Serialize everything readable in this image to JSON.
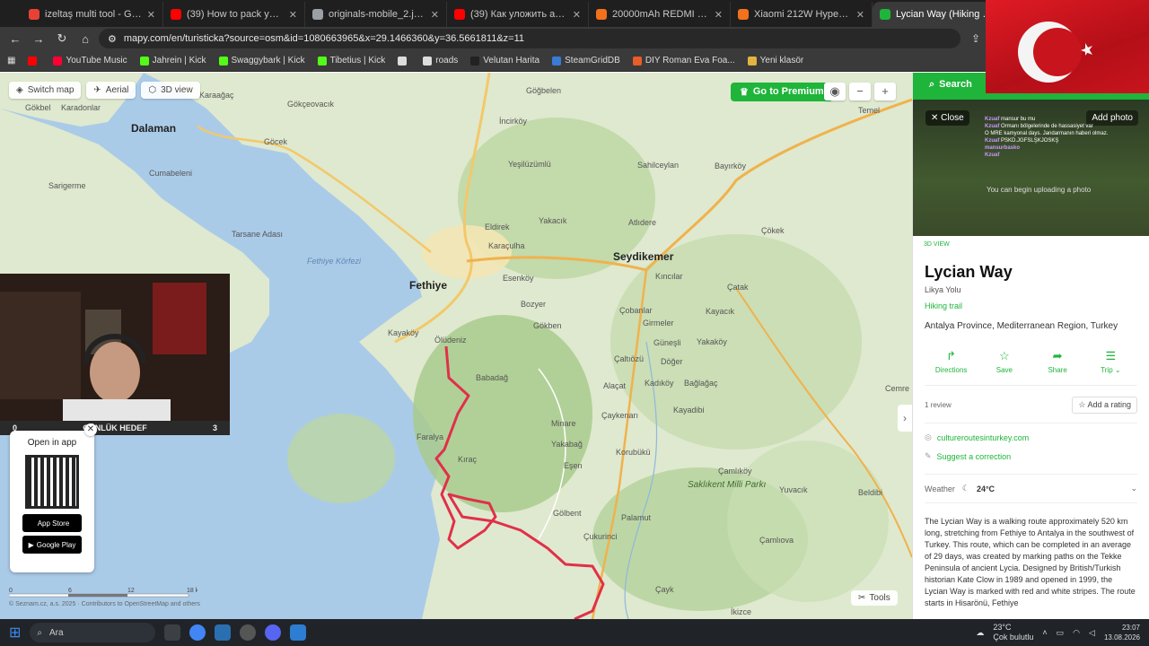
{
  "browser": {
    "tabs": [
      {
        "title": "izeltaş multi tool - Google Alışv",
        "color": "#e94235"
      },
      {
        "title": "(39) How to pack your backpac",
        "color": "#ff0000"
      },
      {
        "title": "originals-mobile_2.jpg (1000×",
        "color": "#9aa0a6"
      },
      {
        "title": "(39) Как уложить алкаша без",
        "color": "#ff0000"
      },
      {
        "title": "20000mAh REDMI 18W Fast Ch",
        "color": "#f2711c"
      },
      {
        "title": "Xiaomi 212W HyperCharge Po",
        "color": "#f2711c"
      },
      {
        "title": "Lycian Way (Hiking trail) • M",
        "color": "#1eb53a"
      }
    ],
    "url": "mapy.com/en/turisticka?source=osm&id=1080663965&x=29.1466360&y=36.5661811&z=11",
    "bookmarks": [
      {
        "label": "",
        "color": "#ff0000"
      },
      {
        "label": "YouTube Music",
        "color": "#ff0033"
      },
      {
        "label": "Jahrein | Kick",
        "color": "#53fc18"
      },
      {
        "label": "Swaggybark | Kick",
        "color": "#53fc18"
      },
      {
        "label": "Tibetius | Kick",
        "color": "#53fc18"
      },
      {
        "label": "",
        "color": "#dddddd"
      },
      {
        "label": "roads",
        "color": "#dddddd"
      },
      {
        "label": "Velutan Harita",
        "color": "#222222"
      },
      {
        "label": "SteamGridDB",
        "color": "#3a7bd5"
      },
      {
        "label": "DIY Roman Eva Foa...",
        "color": "#e85d2a"
      },
      {
        "label": "Yeni klasör",
        "color": "#e3b341"
      }
    ]
  },
  "map": {
    "controls": {
      "switch": "Switch map",
      "aerial": "Aerial",
      "view3d": "3D view"
    },
    "premium": "Go to Premium",
    "tools": "Tools",
    "labels": {
      "dalaman": "Dalaman",
      "fethiye": "Fethiye",
      "seydikemer": "Seydikemer",
      "gocek": "Göcek",
      "gokbel": "Gökbel",
      "karadonlar": "Karadonlar",
      "gokcekovacik": "Gökçeovacık",
      "karaagac": "Karaağaç",
      "cumabeleni": "Cumabeleni",
      "sarigerme": "Sarigerme",
      "gogbelen": "Göğbelen",
      "incirkoy": "İncirköy",
      "yesiluzumlu": "Yeşilüzümlü",
      "sahilceylan": "Sahilceylan",
      "bayirkoy": "Bayırköy",
      "temel": "Temel",
      "yakacik": "Yakacık",
      "atlidere": "Atlıdere",
      "eldirek": "Eldirek",
      "karaculha": "Karaçulha",
      "cokek": "Çökek",
      "kincilar": "Kıncılar",
      "esenkoy": "Esenköy",
      "bozyer": "Bozyer",
      "gokben": "Gökben",
      "catak": "Çatak",
      "cobanlar": "Çobanlar",
      "girmeler": "Girmeler",
      "kayacik": "Kayacık",
      "gunesli": "Güneşli",
      "yakakoy": "Yakaköy",
      "caltiozu": "Çaltıözü",
      "doger": "Döğer",
      "alacat": "Alaçat",
      "kadikoy": "Kadıköy",
      "baglagac": "Bağlağaç",
      "cayken": "Çaykenarı",
      "kayadibi": "Kayadibi",
      "minare": "Minare",
      "yakabag": "Yakabağ",
      "korubuk": "Korubükü",
      "esen": "Eşen",
      "camlikoy": "Çamlıköy",
      "saklikent": "Saklıkent Milli Parkı",
      "yuvacik": "Yuvacık",
      "beldibi": "Beldibi",
      "golbent": "Gölbent",
      "palamut": "Palamut",
      "cukurinci": "Çukurinci",
      "camlova": "Çamlıova",
      "cayk": "Çayk",
      "ikizce": "İkizce",
      "kayakoy": "Kayaköy",
      "oludeniz": "Ölüdeniz",
      "farala": "Faralya",
      "kirac": "Kıraç",
      "cemre": "Cemre",
      "tarsan": "Tarsane Adası",
      "fethiyekorfezi": "Fethiye Körfezi",
      "bozdag": "Babadağ"
    },
    "scale": [
      "0",
      "6",
      "12",
      "18 km"
    ],
    "copyright": "© Seznam.cz, a.s. 2025 · Contributors to OpenStreetMap and others"
  },
  "webcam": {
    "left": "0",
    "label": "GÜNLÜK HEDEF",
    "right": "3"
  },
  "openapp": {
    "title": "Open in app",
    "appstore": "App Store",
    "googleplay": "Google Play"
  },
  "panel": {
    "search": "Search",
    "close": "Close",
    "addphoto": "Add photo",
    "view3d": "3D VIEW",
    "chat": [
      {
        "u": "Kzuaf",
        "m": "mansur bu mu"
      },
      {
        "u": "Kzuaf",
        "m": "Ormanı bölgelerinde de hassasiyet var"
      },
      {
        "u": "",
        "m": "O MRE kamyonal days. Jandarmanın haberi olmaz."
      },
      {
        "u": "Kzuaf",
        "m": "PSKD.JGFSLŞKJOSKŞ"
      },
      {
        "u": "mansurbasko",
        "m": ""
      },
      {
        "u": "Kzuaf",
        "m": ""
      }
    ],
    "chatnotice": "You can begin uploading a photo",
    "title": "Lycian Way",
    "subtitle": "Likya Yolu",
    "type": "Hiking trail",
    "location": "Antalya Province, Mediterranean Region, Turkey",
    "actions": [
      {
        "label": "Directions",
        "icon": "↱"
      },
      {
        "label": "Save",
        "icon": "☆"
      },
      {
        "label": "Share",
        "icon": "➦"
      },
      {
        "label": "Trip ⌄",
        "icon": "☰"
      }
    ],
    "reviews": "1 review",
    "rate": "Add a rating",
    "website": "cultureroutesinturkey.com",
    "suggest": "Suggest a correction",
    "weather_label": "Weather",
    "weather_temp": "24°C",
    "description": "The Lycian Way is a walking route approximately 520 km long, stretching from Fethiye to Antalya in the southwest of Turkey. This route, which can be completed in an average of 29 days, was created by marking paths on the Tekke Peninsula of ancient Lycia. Designed by British/Turkish historian Kate Clow in 1989 and opened in 1999, the Lycian Way is marked with red and white stripes. The route starts in Hisarönü, Fethiye"
  },
  "taskbar": {
    "search": "Ara",
    "weather_temp": "23°C",
    "weather_desc": "Çok bulutlu",
    "time": "23:07",
    "date": "13.08.2026"
  },
  "colors": {
    "accent": "#1eb53a",
    "route": "#e0304a",
    "sea": "#aacbe8",
    "land": "#dfe9cf"
  }
}
